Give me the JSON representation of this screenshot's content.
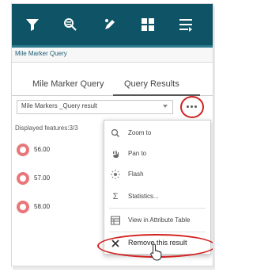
{
  "toolbar": {
    "buttons": [
      {
        "name": "filter-icon"
      },
      {
        "name": "query-icon"
      },
      {
        "name": "edit-icon"
      },
      {
        "name": "grid-icon"
      },
      {
        "name": "list-icon"
      }
    ]
  },
  "panel": {
    "title": "Mile Marker Query"
  },
  "tabs": [
    {
      "label": "Mile Marker Query",
      "active": false
    },
    {
      "label": "Query Results",
      "active": true
    }
  ],
  "results": {
    "selected_layer": "Mile Markers _Query result",
    "displayed_features": "Displayed features:3/3",
    "features": [
      {
        "value": "56.00"
      },
      {
        "value": "57.00"
      },
      {
        "value": "58.00"
      }
    ]
  },
  "menu": {
    "items": [
      {
        "label": "Zoom to",
        "icon": "zoom-icon"
      },
      {
        "label": "Pan to",
        "icon": "pan-icon"
      },
      {
        "label": "Flash",
        "icon": "flash-icon"
      },
      {
        "label": "Statistics...",
        "icon": "sigma-icon"
      },
      {
        "label": "View in Attribute Table",
        "icon": "table-icon"
      },
      {
        "label": "Remove this result",
        "icon": "close-icon"
      }
    ]
  },
  "colors": {
    "toolbar": "#0f5466",
    "highlight": "#d22121",
    "marker": "#e8777c"
  }
}
